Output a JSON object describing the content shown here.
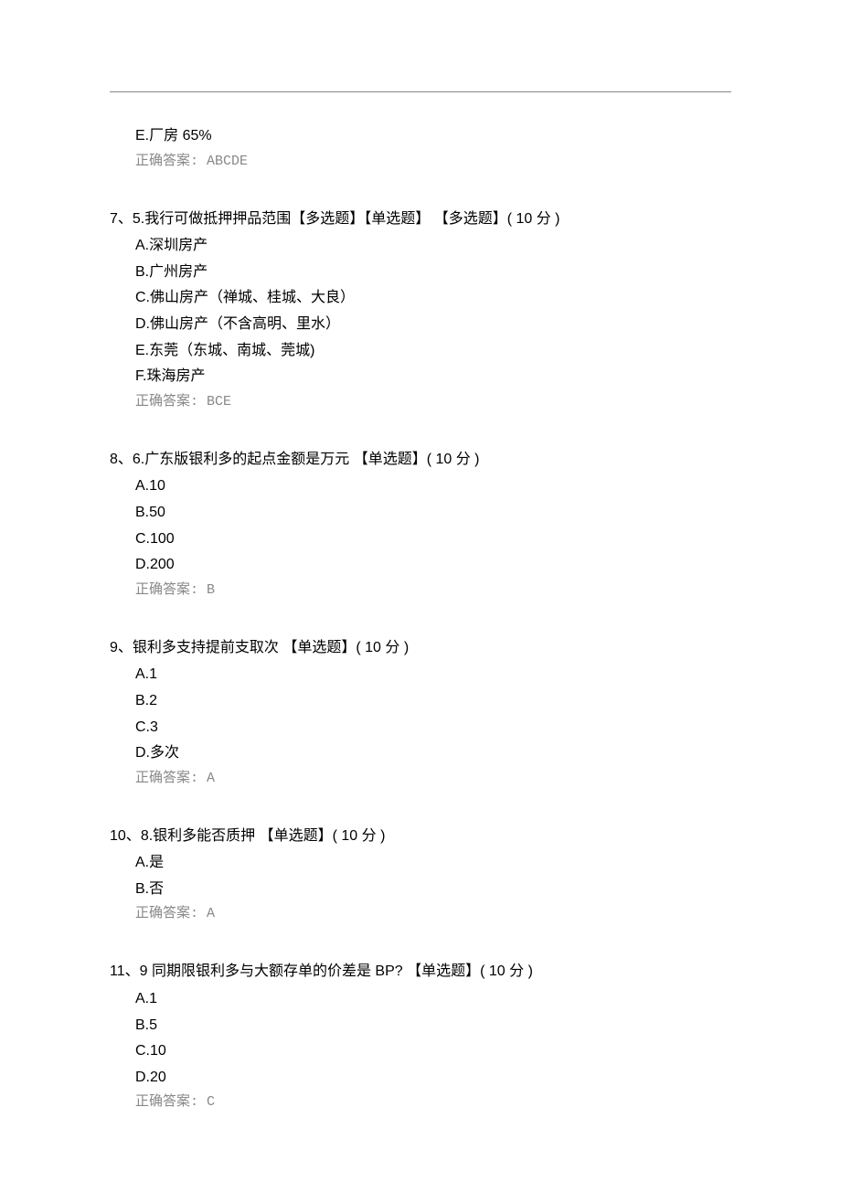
{
  "leadingOptions": [
    {
      "text": "E.厂房 65%"
    }
  ],
  "leadingAnswerLabel": "正确答案:",
  "leadingAnswerValue": "ABCDE",
  "questions": [
    {
      "number": "7、",
      "text": "5.我行可做抵押押品范围",
      "tags": "【多选题】【单选题】  【多选题】",
      "points": "( 10 分 )",
      "options": [
        "A.深圳房产",
        "B.广州房产",
        "C.佛山房产（禅城、桂城、大良）",
        "D.佛山房产（不含高明、里水）",
        "E.东莞（东城、南城、莞城)",
        "F.珠海房产"
      ],
      "answerLabel": "正确答案:",
      "answerValue": "BCE"
    },
    {
      "number": "8、",
      "text": "6.广东版银利多的起点金额是万元",
      "tags": "  【单选题】",
      "points": "( 10 分 )",
      "options": [
        "A.10",
        "B.50",
        "C.100",
        "D.200"
      ],
      "answerLabel": "正确答案:",
      "answerValue": "B"
    },
    {
      "number": "9、",
      "text": "银利多支持提前支取次",
      "tags": "  【单选题】",
      "points": "( 10 分 )",
      "options": [
        "A.1",
        "B.2",
        "C.3",
        "D.多次"
      ],
      "answerLabel": "正确答案:",
      "answerValue": "A"
    },
    {
      "number": "10、",
      "text": "8.银利多能否质押",
      "tags": "  【单选题】",
      "points": "( 10 分 )",
      "options": [
        "A.是",
        "B.否"
      ],
      "answerLabel": "正确答案:",
      "answerValue": "A"
    },
    {
      "number": "11、",
      "text": "9 同期限银利多与大额存单的价差是 BP?",
      "tags": "   【单选题】",
      "points": "( 10 分 )",
      "options": [
        "A.1",
        "B.5",
        "C.10",
        "D.20"
      ],
      "answerLabel": "正确答案:",
      "answerValue": "C"
    }
  ]
}
